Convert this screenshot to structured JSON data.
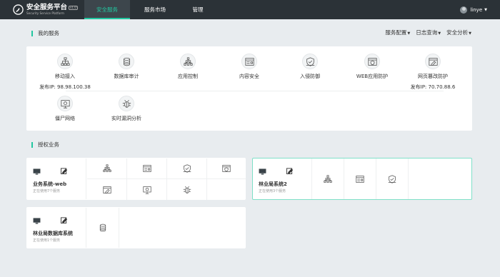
{
  "app": {
    "title": "安全服务平台",
    "version": "v1.0",
    "subtitle": "Security Service Platform"
  },
  "nav": {
    "items": [
      {
        "label": "安全服务",
        "active": true
      },
      {
        "label": "服务市场"
      },
      {
        "label": "管理"
      }
    ]
  },
  "user": {
    "name": "linye"
  },
  "my_services": {
    "title": "我的服务",
    "links": [
      "服务配置",
      "日志查询",
      "安全分析"
    ],
    "items": [
      {
        "label": "移动接入",
        "icon": "network-icon",
        "ip": "发布IP: 98.98.100.38"
      },
      {
        "label": "数据库审计",
        "icon": "database-icon"
      },
      {
        "label": "应用控制",
        "icon": "app-tree-icon"
      },
      {
        "label": "内容安全",
        "icon": "content-icon"
      },
      {
        "label": "入侵防御",
        "icon": "shield-icon"
      },
      {
        "label": "WEB应用防护",
        "icon": "web-shield-icon"
      },
      {
        "label": "网页篡改防护",
        "icon": "web-tamper-icon",
        "ip": "发布IP: 70.70.88.6"
      },
      {
        "label": "僵尸网络",
        "icon": "monitor-icon"
      },
      {
        "label": "实时漏洞分析",
        "icon": "bug-icon"
      }
    ]
  },
  "authorized": {
    "title": "授权业务",
    "cards": [
      {
        "name": "业务系统-web",
        "sub": "正在使用7个服务"
      },
      {
        "name": "林业局系统2",
        "sub": "正在使用3个服务"
      },
      {
        "name": "林业局数据库系统",
        "sub": "正在使用1个服务"
      }
    ]
  },
  "colors": {
    "accent": "#22c7a0",
    "topbar": "#2b3237",
    "background": "#e8ecef"
  }
}
